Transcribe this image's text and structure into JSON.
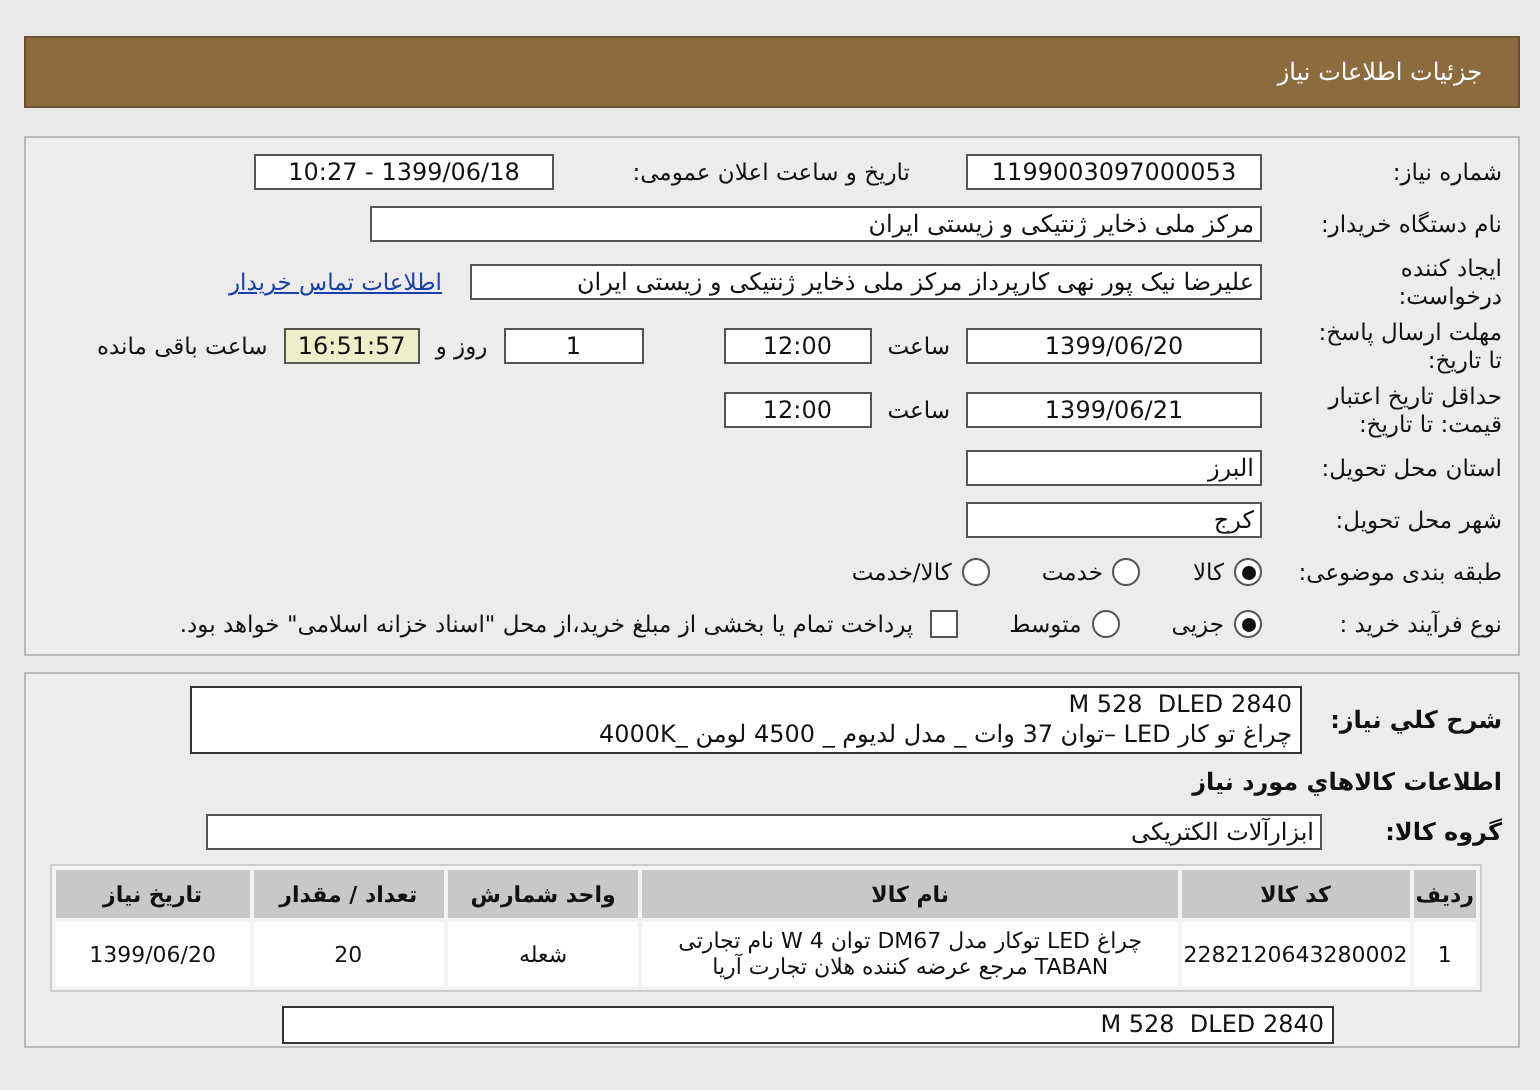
{
  "header": {
    "title": "جزئیات اطلاعات نیاز"
  },
  "need_number": {
    "label": "شماره نیاز:",
    "value": "1199003097000053"
  },
  "announce": {
    "label": "تاریخ و ساعت اعلان عمومی:",
    "value": "1399/06/18 - 10:27"
  },
  "buyer": {
    "label": "نام دستگاه خریدار:",
    "value": "مرکز ملی ذخایر ژنتیکی و زیستی ایران"
  },
  "requester": {
    "label": "ایجاد کننده درخواست:",
    "value": "علیرضا نیک پور نهی کارپرداز مرکز ملی ذخایر ژنتیکی و زیستی ایران",
    "link": "اطلاعات تماس خریدار"
  },
  "deadline": {
    "label": "مهلت ارسال پاسخ: تا تاریخ:",
    "date": "1399/06/20",
    "time_label": "ساعت",
    "time": "12:00",
    "days": "1",
    "days_label": "روز و",
    "remaining": "16:51:57",
    "remaining_label": "ساعت باقی مانده"
  },
  "validity": {
    "label": "حداقل تاریخ اعتبار قیمت: تا تاریخ:",
    "date": "1399/06/21",
    "time_label": "ساعت",
    "time": "12:00"
  },
  "province": {
    "label": "استان محل تحویل:",
    "value": "البرز"
  },
  "city": {
    "label": "شهر محل تحویل:",
    "value": "کرج"
  },
  "category": {
    "label": "طبقه بندی موضوعی:",
    "options": [
      {
        "label": "کالا",
        "selected": true
      },
      {
        "label": "خدمت",
        "selected": false
      },
      {
        "label": "کالا/خدمت",
        "selected": false
      }
    ]
  },
  "purchase_type": {
    "label": "نوع فرآیند خرید :",
    "options": [
      {
        "label": "جزیی",
        "selected": true
      },
      {
        "label": "متوسط",
        "selected": false
      }
    ],
    "treasury": {
      "label": "پرداخت تمام یا بخشی از مبلغ خرید،از محل \"اسناد خزانه اسلامی\" خواهد بود.",
      "checked": false
    }
  },
  "description": {
    "label": "شرح كلي نياز:",
    "lines": [
      "M 528  DLED 2840",
      "چراغ تو کار LED –توان 37 وات _ مدل لدیوم _ 4500 لومن _4000K"
    ]
  },
  "goods_heading": "اطلاعات كالاهاي مورد نياز",
  "goods_group": {
    "label": "گروه کالا:",
    "value": "ابزارآلات الکتریکی"
  },
  "table": {
    "columns": [
      "ردیف",
      "کد کالا",
      "نام کالا",
      "واحد شمارش",
      "تعداد / مقدار",
      "تاریخ نیاز"
    ],
    "rows": [
      {
        "cells": [
          "1",
          "2282120643280002",
          "چراغ LED توکار مدل DM67 توان 4 W نام تجارتی TABAN مرجع عرضه کننده هلان تجارت آریا",
          "شعله",
          "20",
          "1399/06/20"
        ]
      }
    ]
  },
  "footer_description": {
    "lines": [
      "M 528  DLED 2840"
    ]
  }
}
